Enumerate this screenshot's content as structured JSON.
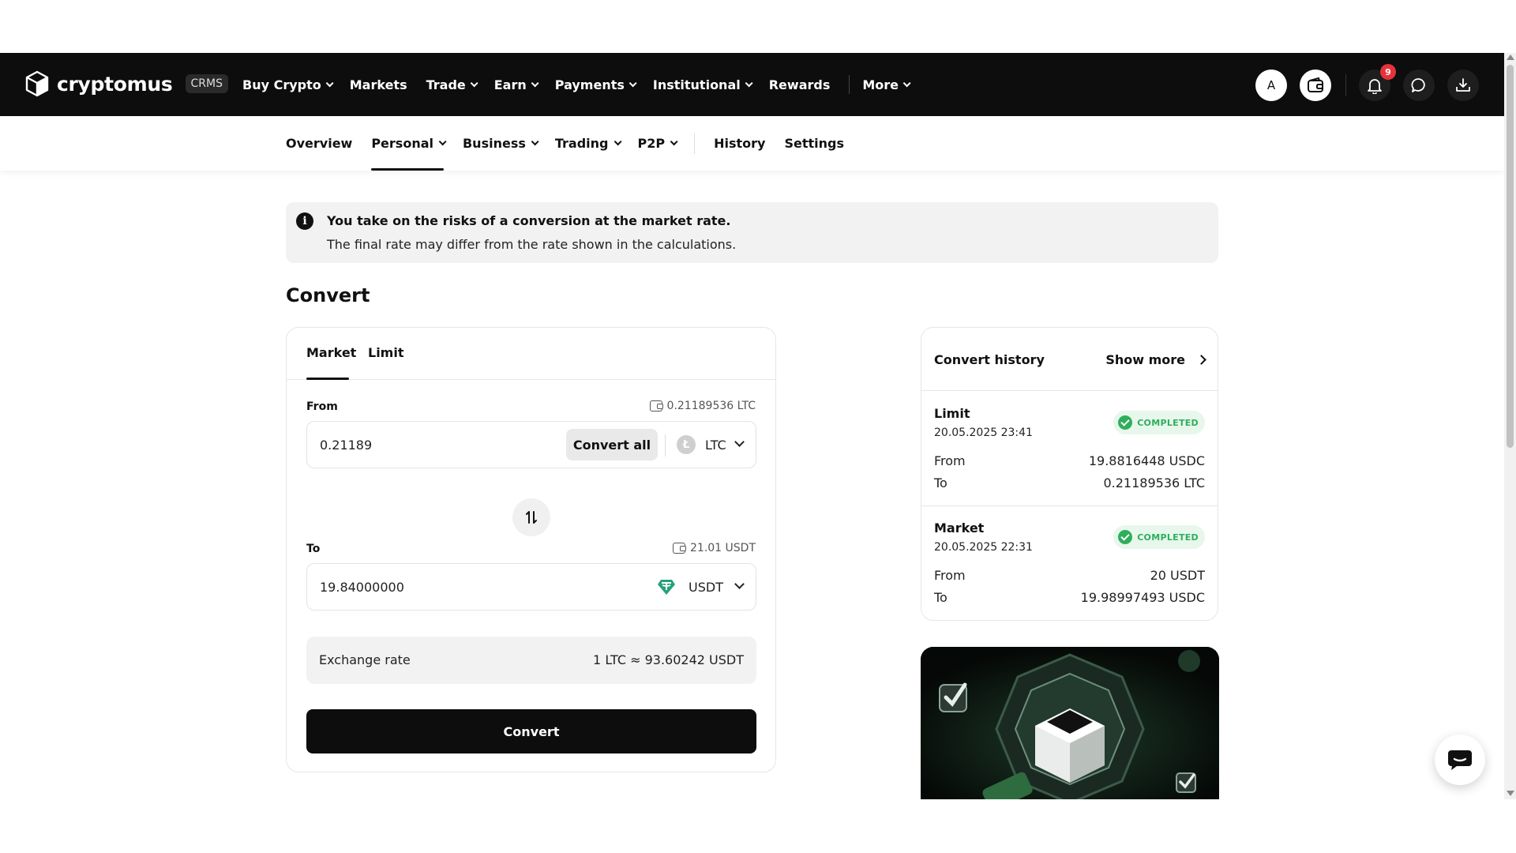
{
  "header": {
    "logo_text": "cryptomus",
    "crms_badge": "CRMS",
    "nav": [
      {
        "label": "Buy Crypto",
        "dropdown": true
      },
      {
        "label": "Markets",
        "dropdown": false
      },
      {
        "label": "Trade",
        "dropdown": true
      },
      {
        "label": "Earn",
        "dropdown": true
      },
      {
        "label": "Payments",
        "dropdown": true
      },
      {
        "label": "Institutional",
        "dropdown": true
      },
      {
        "label": "Rewards",
        "dropdown": false
      },
      {
        "label": "More",
        "dropdown": true
      }
    ],
    "avatar_letter": "A",
    "notification_count": "9",
    "icons": [
      "wallet-icon",
      "bell-icon",
      "chat-icon",
      "download-icon"
    ]
  },
  "subnav": {
    "items": [
      {
        "label": "Overview",
        "dropdown": false
      },
      {
        "label": "Personal",
        "dropdown": true,
        "active": true
      },
      {
        "label": "Business",
        "dropdown": true
      },
      {
        "label": "Trading",
        "dropdown": true
      },
      {
        "label": "P2P",
        "dropdown": true
      },
      {
        "label": "History",
        "dropdown": false
      },
      {
        "label": "Settings",
        "dropdown": false
      }
    ]
  },
  "banner": {
    "title": "You take on the risks of a conversion at the market rate.",
    "text": "The final rate may differ from the rate shown in the calculations."
  },
  "page_title": "Convert",
  "converter": {
    "tabs": [
      "Market",
      "Limit"
    ],
    "active_tab": "Market",
    "from": {
      "label": "From",
      "balance": "0.21189536 LTC",
      "value": "0.21189",
      "convert_all_label": "Convert all",
      "currency": "LTC"
    },
    "to": {
      "label": "To",
      "balance": "21.01 USDT",
      "value": "19.84000000",
      "currency": "USDT"
    },
    "rate_label": "Exchange rate",
    "rate_value": "1 LTC ≈ 93.60242 USDT",
    "convert_button": "Convert"
  },
  "history": {
    "title": "Convert history",
    "show_more": "Show more",
    "entries": [
      {
        "type": "Limit",
        "date": "20.05.2025 23:41",
        "status": "COMPLETED",
        "from_label": "From",
        "from_value": "19.8816448 USDC",
        "to_label": "To",
        "to_value": "0.21189536 LTC"
      },
      {
        "type": "Market",
        "date": "20.05.2025 22:31",
        "status": "COMPLETED",
        "from_label": "From",
        "from_value": "20 USDT",
        "to_label": "To",
        "to_value": "19.98997493 USDC"
      }
    ]
  },
  "colors": {
    "header_bg": "#0d0d0d",
    "status_green": "#2fae5c",
    "status_bg": "#e7f7ec",
    "usdt_green": "#26a17b",
    "badge_red": "#e5323b"
  }
}
